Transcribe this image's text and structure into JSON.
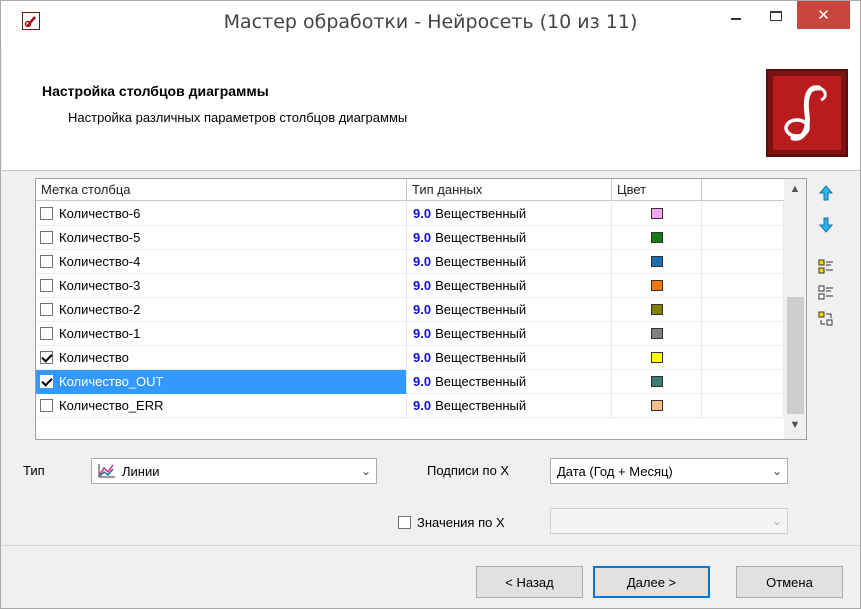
{
  "window": {
    "title": "Мастер обработки - Нейросеть (10 из 11)",
    "close_label": "✕",
    "accent_close": "#c7463d"
  },
  "header": {
    "title": "Настройка столбцов диаграммы",
    "subtitle": "Настройка различных параметров столбцов диаграммы"
  },
  "table": {
    "columns": [
      "Метка столбца",
      "Тип данных",
      "Цвет",
      ""
    ],
    "rows": [
      {
        "label": "Количество-6",
        "checked": false,
        "type_code": "9.0",
        "type_name": "Вещественный",
        "color": "#f4a6f4",
        "selected": false
      },
      {
        "label": "Количество-5",
        "checked": false,
        "type_code": "9.0",
        "type_name": "Вещественный",
        "color": "#167a16",
        "selected": false
      },
      {
        "label": "Количество-4",
        "checked": false,
        "type_code": "9.0",
        "type_name": "Вещественный",
        "color": "#1a6fb0",
        "selected": false
      },
      {
        "label": "Количество-3",
        "checked": false,
        "type_code": "9.0",
        "type_name": "Вещественный",
        "color": "#f0780a",
        "selected": false
      },
      {
        "label": "Количество-2",
        "checked": false,
        "type_code": "9.0",
        "type_name": "Вещественный",
        "color": "#808000",
        "selected": false
      },
      {
        "label": "Количество-1",
        "checked": false,
        "type_code": "9.0",
        "type_name": "Вещественный",
        "color": "#808080",
        "selected": false
      },
      {
        "label": "Количество",
        "checked": true,
        "type_code": "9.0",
        "type_name": "Вещественный",
        "color": "#ffff00",
        "selected": false
      },
      {
        "label": "Количество_OUT",
        "checked": true,
        "type_code": "9.0",
        "type_name": "Вещественный",
        "color": "#3a7a70",
        "selected": true
      },
      {
        "label": "Количество_ERR",
        "checked": false,
        "type_code": "9.0",
        "type_name": "Вещественный",
        "color": "#f4c08a",
        "selected": false
      }
    ]
  },
  "side_tools": [
    "move-up-icon",
    "move-down-icon",
    "check-all-icon",
    "uncheck-all-icon",
    "swap-icon"
  ],
  "controls": {
    "type_label": "Тип",
    "type_value": "Линии",
    "x_labels_label": "Подписи по X",
    "x_labels_value": "Дата (Год + Месяц)",
    "x_values_label": "Значения по X",
    "x_values_value": ""
  },
  "footer": {
    "back": "< Назад",
    "next": "Далее >",
    "cancel": "Отмена"
  }
}
